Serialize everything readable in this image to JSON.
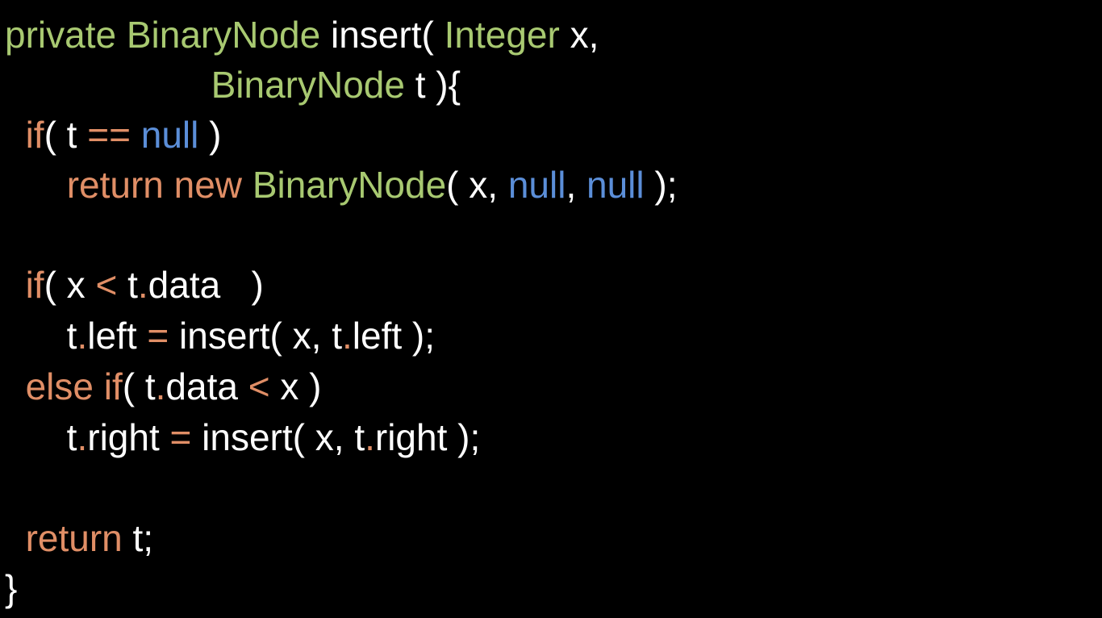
{
  "colors": {
    "background": "#000000",
    "default": "#ffffff",
    "keyword": "#e08e66",
    "type": "#a8c971",
    "literal": "#5b8ed8"
  },
  "code_lines": [
    {
      "tokens": [
        {
          "text": "private ",
          "kind": "type"
        },
        {
          "text": "BinaryNode",
          "kind": "type"
        },
        {
          "text": " insert( ",
          "kind": "default"
        },
        {
          "text": "Integer",
          "kind": "type"
        },
        {
          "text": " x,",
          "kind": "default"
        }
      ]
    },
    {
      "tokens": [
        {
          "text": "                    ",
          "kind": "default"
        },
        {
          "text": "BinaryNode",
          "kind": "type"
        },
        {
          "text": " t ){",
          "kind": "default"
        }
      ]
    },
    {
      "tokens": [
        {
          "text": "  ",
          "kind": "default"
        },
        {
          "text": "if",
          "kind": "keyword"
        },
        {
          "text": "( t ",
          "kind": "default"
        },
        {
          "text": "==",
          "kind": "keyword"
        },
        {
          "text": " ",
          "kind": "default"
        },
        {
          "text": "null",
          "kind": "literal"
        },
        {
          "text": " )",
          "kind": "default"
        }
      ]
    },
    {
      "tokens": [
        {
          "text": "      ",
          "kind": "default"
        },
        {
          "text": "return new ",
          "kind": "keyword"
        },
        {
          "text": "BinaryNode",
          "kind": "type"
        },
        {
          "text": "( x, ",
          "kind": "default"
        },
        {
          "text": "null",
          "kind": "literal"
        },
        {
          "text": ", ",
          "kind": "default"
        },
        {
          "text": "null",
          "kind": "literal"
        },
        {
          "text": " );",
          "kind": "default"
        }
      ]
    },
    {
      "tokens": []
    },
    {
      "tokens": [
        {
          "text": "  ",
          "kind": "default"
        },
        {
          "text": "if",
          "kind": "keyword"
        },
        {
          "text": "( x ",
          "kind": "default"
        },
        {
          "text": "<",
          "kind": "keyword"
        },
        {
          "text": " t",
          "kind": "default"
        },
        {
          "text": ".",
          "kind": "keyword"
        },
        {
          "text": "data   )",
          "kind": "default"
        }
      ]
    },
    {
      "tokens": [
        {
          "text": "      t",
          "kind": "default"
        },
        {
          "text": ".",
          "kind": "keyword"
        },
        {
          "text": "left ",
          "kind": "default"
        },
        {
          "text": "=",
          "kind": "keyword"
        },
        {
          "text": " insert( x, t",
          "kind": "default"
        },
        {
          "text": ".",
          "kind": "keyword"
        },
        {
          "text": "left );",
          "kind": "default"
        }
      ]
    },
    {
      "tokens": [
        {
          "text": "  ",
          "kind": "default"
        },
        {
          "text": "else if",
          "kind": "keyword"
        },
        {
          "text": "( t",
          "kind": "default"
        },
        {
          "text": ".",
          "kind": "keyword"
        },
        {
          "text": "data ",
          "kind": "default"
        },
        {
          "text": "<",
          "kind": "keyword"
        },
        {
          "text": " x )",
          "kind": "default"
        }
      ]
    },
    {
      "tokens": [
        {
          "text": "      t",
          "kind": "default"
        },
        {
          "text": ".",
          "kind": "keyword"
        },
        {
          "text": "right ",
          "kind": "default"
        },
        {
          "text": "=",
          "kind": "keyword"
        },
        {
          "text": " insert( x, t",
          "kind": "default"
        },
        {
          "text": ".",
          "kind": "keyword"
        },
        {
          "text": "right );",
          "kind": "default"
        }
      ]
    },
    {
      "tokens": []
    },
    {
      "tokens": [
        {
          "text": "  ",
          "kind": "default"
        },
        {
          "text": "return",
          "kind": "keyword"
        },
        {
          "text": " t;",
          "kind": "default"
        }
      ]
    },
    {
      "tokens": [
        {
          "text": "}",
          "kind": "default"
        }
      ]
    }
  ]
}
